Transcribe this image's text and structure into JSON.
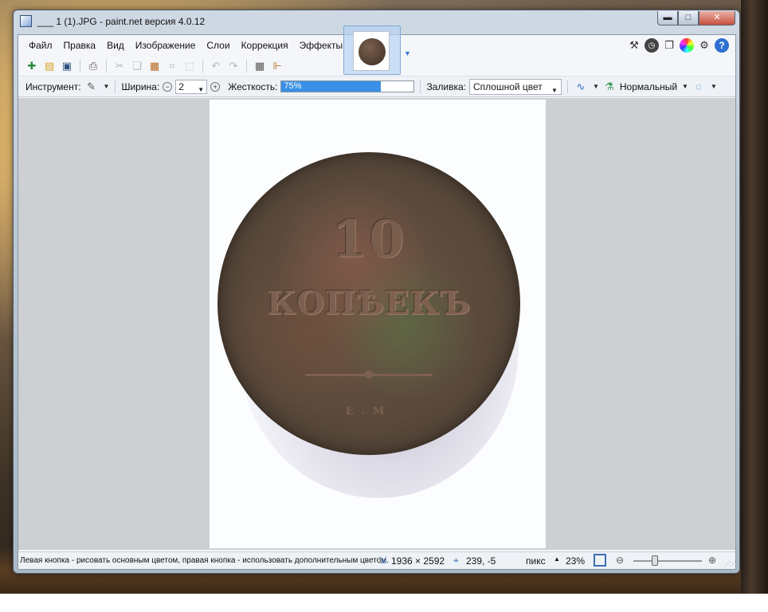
{
  "window": {
    "title": "___ 1 (1).JPG - paint.net версия 4.0.12",
    "minimize": "▬",
    "maximize": "□",
    "close": "✕"
  },
  "menu": [
    "Файл",
    "Правка",
    "Вид",
    "Изображение",
    "Слои",
    "Коррекция",
    "Эффекты"
  ],
  "toolbar2": {
    "tool_label": "Инструмент:",
    "width_label": "Ширина:",
    "width_value": "2",
    "hardness_label": "Жесткость:",
    "hardness_value": "75%",
    "hardness_fraction": 0.75,
    "fill_label": "Заливка:",
    "fill_value": "Сплошной цвет",
    "blend_value": "Нормальный"
  },
  "status": {
    "hint": "Левая кнопка - рисовать основным цветом, правая кнопка - использовать дополнительным цветом.",
    "image_size": "1936 × 2592",
    "cursor": "239, -5",
    "units": "пикс",
    "zoom": "23%"
  },
  "image": {
    "coin_value": "10",
    "coin_word": "КОПѢЕКЪ",
    "mint": "Е.М"
  },
  "icons": {
    "new": "new-image-icon",
    "open": "open-icon",
    "save": "save-icon",
    "print": "print-icon",
    "cut": "cut-icon",
    "copy": "copy-icon",
    "paste": "paste-icon",
    "crop": "crop-icon",
    "deselect": "deselect-icon",
    "undo": "undo-icon",
    "redo": "redo-icon",
    "grid": "grid-icon",
    "ruler": "ruler-icon"
  },
  "colors": {
    "accent": "#3a90e6",
    "workspace": "#cdcfd2"
  }
}
